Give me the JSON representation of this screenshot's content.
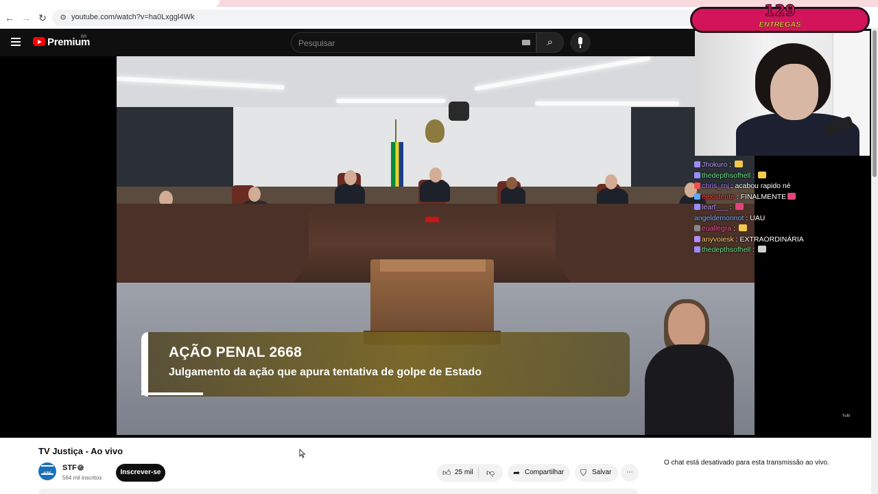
{
  "browser": {
    "url": "youtube.com/watch?v=ha0Lxggl4Wk"
  },
  "header": {
    "brand": "Premium",
    "region": "BR",
    "search_placeholder": "Pesquisar"
  },
  "video": {
    "overlay_title": "AÇÃO PENAL 2668",
    "overlay_subtitle": "Julgamento da ação que apura tentativa de golpe de Estado",
    "watermark": "TV JUSTIÇA",
    "channel_watermark": "ᵀᵛᴶᵁ"
  },
  "stream_overlay": {
    "counter_number": "129",
    "counter_label": "ENTREGAS",
    "chat": [
      {
        "user": "Jhokuro",
        "user_color": "#b89cff",
        "message": "",
        "emote_color": "#f2c94c",
        "badge_color": "#9b8cff"
      },
      {
        "user": "thedepthsofhell",
        "user_color": "#6ee38a",
        "message": "",
        "emote_color": "#f2c94c",
        "badge_color": "#9b8cff"
      },
      {
        "user": "chris_rnj",
        "user_color": "#b07cff",
        "message": "acabou rapido né",
        "emote_color": "",
        "badge_color": "#ff4d4d"
      },
      {
        "user": "eexistente",
        "user_color": "#ff3b3b",
        "message": "FINALMENTE",
        "emote_color": "#e0457b",
        "badge_color": "#5aa8ff"
      },
      {
        "user": "learf___",
        "user_color": "#b89cff",
        "message": "",
        "emote_color": "#e0457b",
        "badge_color": "#9b8cff"
      },
      {
        "user": "angeldemonnot",
        "user_color": "#7fb2ff",
        "message": "UAU",
        "emote_color": "",
        "badge_color": ""
      },
      {
        "user": "euallegra",
        "user_color": "#ff4fa3",
        "message": "",
        "emote_color": "#f2c94c",
        "badge_color": "#888888"
      },
      {
        "user": "anyvoiesk",
        "user_color": "#ffd26b",
        "message": "EXTRAORDINÁRIA",
        "emote_color": "",
        "badge_color": "#b58cff"
      },
      {
        "user": "thedepthsofhell",
        "user_color": "#6ee38a",
        "message": "",
        "emote_color": "#d0d0d0",
        "badge_color": "#9b8cff"
      }
    ]
  },
  "below_video": {
    "title": "TV Justiça - Ao vivo",
    "channel_name": "STF",
    "channel_avatar_text": "STF",
    "subscribers": "564 mil inscritos",
    "subscribe_label": "Inscrever-se",
    "likes": "25 mil",
    "share_label": "Compartilhar",
    "save_label": "Salvar",
    "chat_disabled": "O chat está desativado para esta transmissão ao vivo."
  }
}
